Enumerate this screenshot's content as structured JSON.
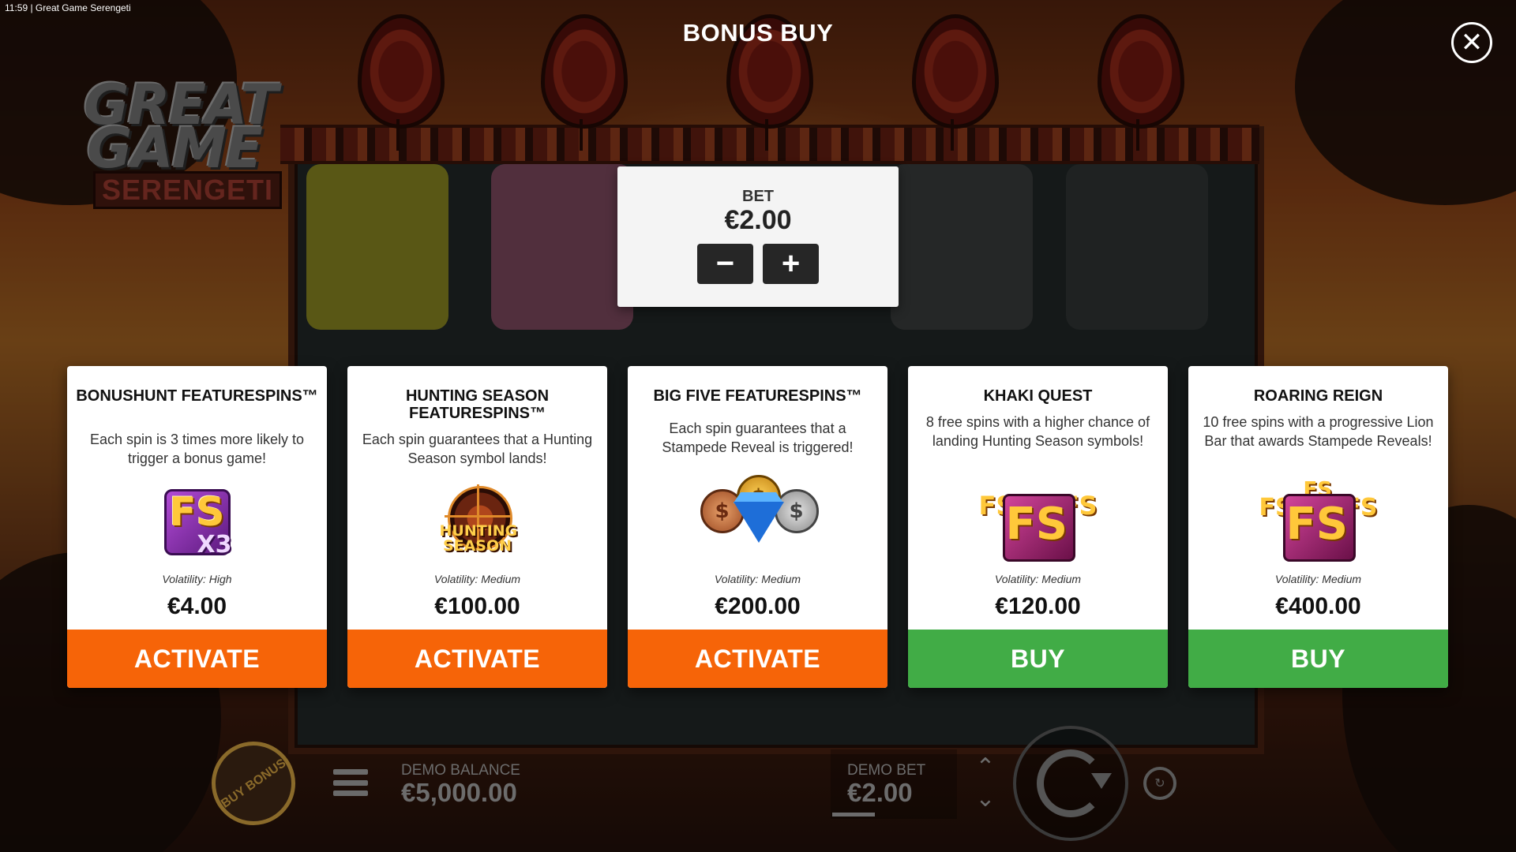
{
  "os_bar": {
    "time": "11:59",
    "window_title": "| Great Game Serengeti"
  },
  "logo": {
    "line1": "GREAT",
    "line2": "GAME",
    "line3": "SERENGETI"
  },
  "modal": {
    "title": "BONUS BUY",
    "close_icon": "close-icon"
  },
  "bet_panel": {
    "label": "BET",
    "value": "€2.00",
    "minus": "−",
    "plus": "+"
  },
  "cards": [
    {
      "title": "BONUSHUNT FEATURESPINS™",
      "description": "Each spin is 3 times more likely to trigger a bonus game!",
      "icon": "fs-x3-icon",
      "icon_text": "FS",
      "icon_sub": "X3",
      "volatility": "Volatility: High",
      "price": "€4.00",
      "button": "ACTIVATE",
      "button_color": "#f66408"
    },
    {
      "title": "HUNTING SEASON FEATURESPINS™",
      "description": "Each spin guarantees that a Hunting Season symbol lands!",
      "icon": "hunting-season-icon",
      "icon_text": "HUNTING SEASON",
      "volatility": "Volatility: Medium",
      "price": "€100.00",
      "button": "ACTIVATE",
      "button_color": "#f66408"
    },
    {
      "title": "BIG FIVE FEATURESPINS™",
      "description": "Each spin guarantees that a Stampede Reveal is triggered!",
      "icon": "coins-diamond-icon",
      "volatility": "Volatility: Medium",
      "price": "€200.00",
      "button": "ACTIVATE",
      "button_color": "#f66408"
    },
    {
      "title": "KHAKI QUEST",
      "description": "8 free spins with a higher chance of landing Hunting Season symbols!",
      "icon": "fs-triple-icon",
      "icon_text": "FS",
      "volatility": "Volatility: Medium",
      "price": "€120.00",
      "button": "BUY",
      "button_color": "#41ac46"
    },
    {
      "title": "ROARING REIGN",
      "description": "10 free spins with a progressive Lion Bar that awards Stampede Reveals!",
      "icon": "fs-quad-icon",
      "icon_text": "FS",
      "volatility": "Volatility: Medium",
      "price": "€400.00",
      "button": "BUY",
      "button_color": "#41ac46"
    }
  ],
  "bottom_bar": {
    "buy_bonus": "BUY BONUS",
    "balance_label": "DEMO BALANCE",
    "balance_value": "€5,000.00",
    "bet_label": "DEMO BET",
    "bet_value": "€2.00"
  }
}
